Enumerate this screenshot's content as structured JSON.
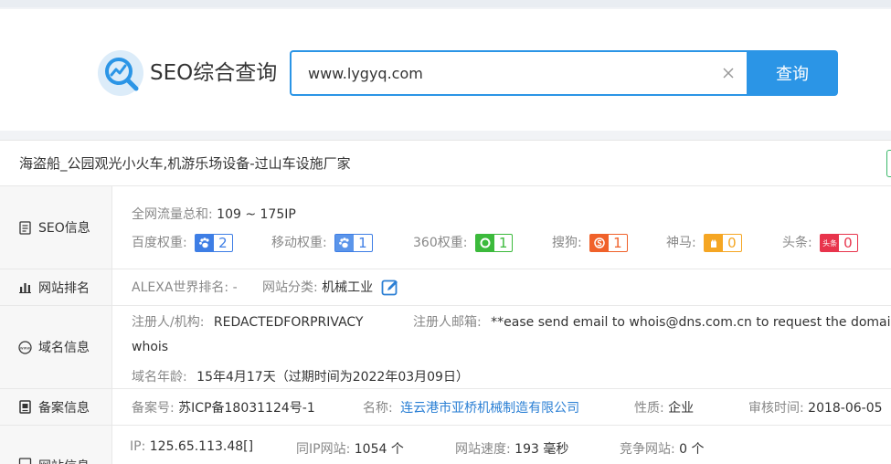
{
  "app": {
    "title": "SEO综合查询"
  },
  "search": {
    "value": "www.lygyq.com",
    "button": "查询"
  },
  "site": {
    "title": "海盗船_公园观光小火车,机游乐场设备-过山车设施厂家"
  },
  "seo": {
    "label": "SEO信息",
    "traffic_key": "全网流量总和:",
    "traffic_value": "109 ~ 175IP",
    "weights": [
      {
        "key": "百度权重:",
        "value": "2",
        "color": "#3e7ee5",
        "icon": "baidu-paw-icon"
      },
      {
        "key": "移动权重:",
        "value": "1",
        "color": "#3e7ee5",
        "icon": "mobile-paw-icon"
      },
      {
        "key": "360权重:",
        "value": "1",
        "color": "#3cba3c",
        "icon": "360-icon"
      },
      {
        "key": "搜狗:",
        "value": "1",
        "color": "#f0612a",
        "icon": "sogou-icon"
      },
      {
        "key": "神马:",
        "value": "0",
        "color": "#f5a623",
        "icon": "shenma-icon"
      },
      {
        "key": "头条:",
        "value": "0",
        "color": "#e8344c",
        "icon": "toutiao-icon",
        "icon_text": "头条"
      }
    ]
  },
  "rank": {
    "label": "网站排名",
    "alexa_key": "ALEXA世界排名:",
    "alexa_value": "-",
    "category_key": "网站分类:",
    "category_value": "机械工业"
  },
  "domain": {
    "label": "域名信息",
    "registrant_key": "注册人/机构:",
    "registrant_value": "REDACTEDFORPRIVACY",
    "email_key": "注册人邮箱:",
    "email_value": "**ease send email to whois@dns.com.cn to request the domain",
    "email_value_cont": "whois",
    "age_key": "域名年龄:",
    "age_value": "15年4月17天（过期时间为2022年03月09日）"
  },
  "icp": {
    "label": "备案信息",
    "number_key": "备案号:",
    "number_value": "苏ICP备18031124号-1",
    "name_key": "名称:",
    "name_value": "连云港市亚桥机械制造有限公司",
    "nature_key": "性质:",
    "nature_value": "企业",
    "audit_key": "审核时间:",
    "audit_value": "2018-06-05"
  },
  "siteinfo": {
    "label": "网站信息",
    "ip_key": "IP:",
    "ip_value": "125.65.113.48[]",
    "sameip_key": "同IP网站:",
    "sameip_value": "1054 个",
    "speed_key": "网站速度:",
    "speed_value": "193 毫秒",
    "compete_key": "竞争网站:",
    "compete_value": "0 个"
  }
}
